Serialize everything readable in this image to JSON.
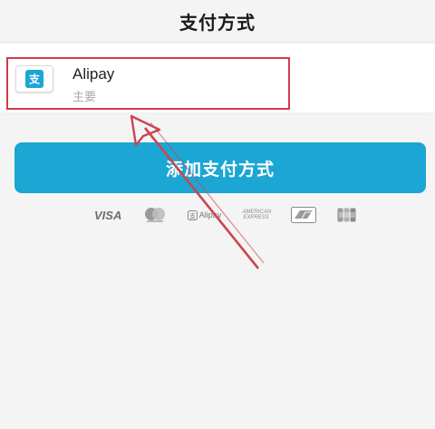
{
  "header": {
    "title": "支付方式"
  },
  "payment_method": {
    "name": "Alipay",
    "sub": "主要",
    "icon": "alipay-icon"
  },
  "add_button": {
    "label": "添加支付方式"
  },
  "card_logos": {
    "visa": "VISA",
    "alipay": "Alipay",
    "amex": "AMERICAN EXPRESS"
  },
  "colors": {
    "accent": "#1ba6d3",
    "highlight": "#d33a4a",
    "background": "#f4f4f4"
  }
}
